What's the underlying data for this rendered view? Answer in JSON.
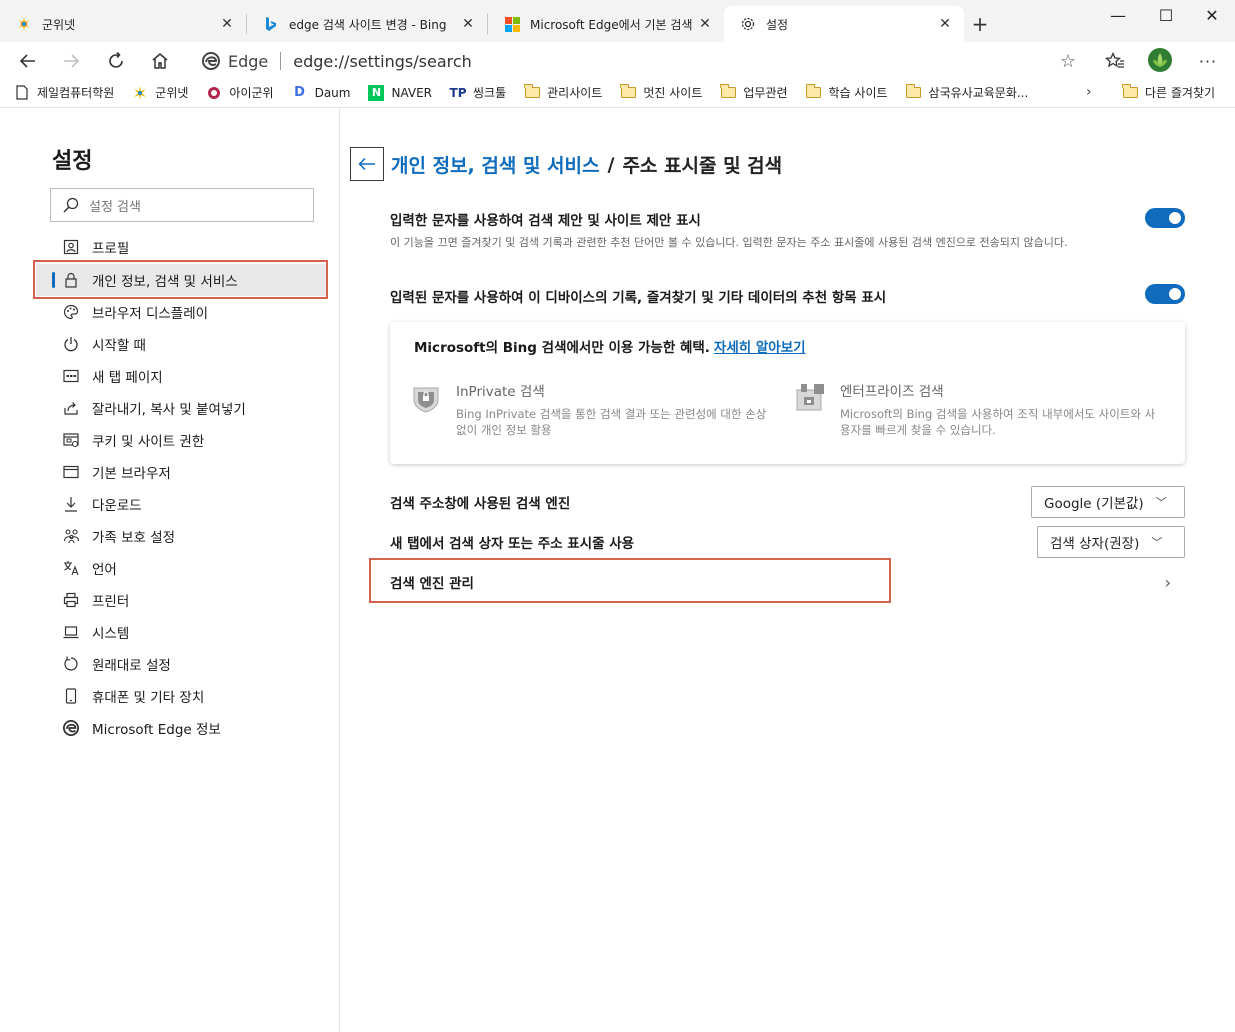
{
  "tabs": [
    {
      "title": "군위넷",
      "icon": "gunwi-logo-icon"
    },
    {
      "title": "edge 검색 사이트 변경 - Bing",
      "icon": "bing-logo-icon"
    },
    {
      "title": "Microsoft Edge에서 기본 검색 엔",
      "icon": "microsoft-logo-icon"
    },
    {
      "title": "설정",
      "icon": "gear-icon",
      "active": true
    }
  ],
  "window_controls": {
    "minimize": "—",
    "maximize": "☐",
    "close": "✕"
  },
  "address_bar": {
    "site_label": "Edge",
    "url": "edge://settings/search"
  },
  "favorites": [
    {
      "label": "제일컴퓨터학원",
      "icon": "page-icon"
    },
    {
      "label": "군위넷",
      "icon": "gunwi-logo-icon"
    },
    {
      "label": "아이군위",
      "icon": "igunwi-logo-icon"
    },
    {
      "label": "Daum",
      "icon": "daum-logo-icon"
    },
    {
      "label": "NAVER",
      "icon": "naver-logo-icon"
    },
    {
      "label": "씽크툴",
      "icon": "thinktool-logo-icon"
    },
    {
      "label": "관리사이트",
      "icon": "folder-icon"
    },
    {
      "label": "멋진 사이트",
      "icon": "folder-icon"
    },
    {
      "label": "업무관련",
      "icon": "folder-icon"
    },
    {
      "label": "학습 사이트",
      "icon": "folder-icon"
    },
    {
      "label": "삼국유사교육문화...",
      "icon": "folder-icon"
    }
  ],
  "favorites_other": "다른 즐겨찾기",
  "sidebar": {
    "title": "설정",
    "search_placeholder": "설정 검색",
    "items": [
      {
        "label": "프로필",
        "icon": "profile-icon"
      },
      {
        "label": "개인 정보, 검색 및 서비스",
        "icon": "lock-icon",
        "selected": true
      },
      {
        "label": "브라우저 디스플레이",
        "icon": "palette-icon"
      },
      {
        "label": "시작할 때",
        "icon": "power-icon"
      },
      {
        "label": "새 탭 페이지",
        "icon": "new-tab-icon"
      },
      {
        "label": "잘라내기, 복사 및 붙여넣기",
        "icon": "share-icon"
      },
      {
        "label": "쿠키 및 사이트 권한",
        "icon": "site-permissions-icon"
      },
      {
        "label": "기본 브라우저",
        "icon": "browser-icon"
      },
      {
        "label": "다운로드",
        "icon": "download-icon"
      },
      {
        "label": "가족 보호 설정",
        "icon": "family-icon"
      },
      {
        "label": "언어",
        "icon": "language-icon"
      },
      {
        "label": "프린터",
        "icon": "printer-icon"
      },
      {
        "label": "시스템",
        "icon": "laptop-icon"
      },
      {
        "label": "원래대로 설정",
        "icon": "reset-icon"
      },
      {
        "label": "휴대폰 및 기타 장치",
        "icon": "phone-icon"
      },
      {
        "label": "Microsoft Edge 정보",
        "icon": "edge-logo-icon"
      }
    ]
  },
  "content": {
    "breadcrumb_parent": "개인 정보, 검색 및 서비스",
    "breadcrumb_sep": "/",
    "breadcrumb_current": "주소 표시줄 및 검색",
    "setting1": {
      "title": "입력한 문자를 사용하여 검색 제안 및 사이트 제안 표시",
      "desc": "이 기능을 끄면 즐겨찾기 및 검색 기록과 관련한 추천 단어만 볼 수 있습니다. 입력한 문자는 주소 표시줄에 사용된 검색 엔진으로 전송되지 않습니다.",
      "enabled": true
    },
    "setting2": {
      "title": "입력된 문자를 사용하여 이 디바이스의 기록, 즐겨찾기 및 기타 데이터의 추천 항목 표시",
      "enabled": true
    },
    "bing_card": {
      "heading": "Microsoft의 Bing 검색에서만 이용 가능한 혜택.",
      "link": "자세히 알아보기",
      "benefits": [
        {
          "title": "InPrivate 검색",
          "desc": "Bing InPrivate 검색을 통한 검색 결과 또는 관련성에 대한 손상 없이 개인 정보 활용",
          "icon": "inprivate-search-icon"
        },
        {
          "title": "엔터프라이즈 검색",
          "desc": "Microsoft의 Bing 검색을 사용하여 조직 내부에서도 사이트와 사용자를 빠르게 찾을 수 있습니다.",
          "icon": "enterprise-search-icon"
        }
      ]
    },
    "engine_row": {
      "label": "검색 주소창에 사용된 검색 엔진",
      "value": "Google (기본값)"
    },
    "newtab_row": {
      "label": "새 탭에서 검색 상자 또는 주소 표시줄 사용",
      "value": "검색 상자(권장)"
    },
    "manage_row": {
      "label": "검색 엔진 관리"
    }
  },
  "colors": {
    "accent": "#0f6cbd",
    "highlight_box": "#d4604e"
  }
}
